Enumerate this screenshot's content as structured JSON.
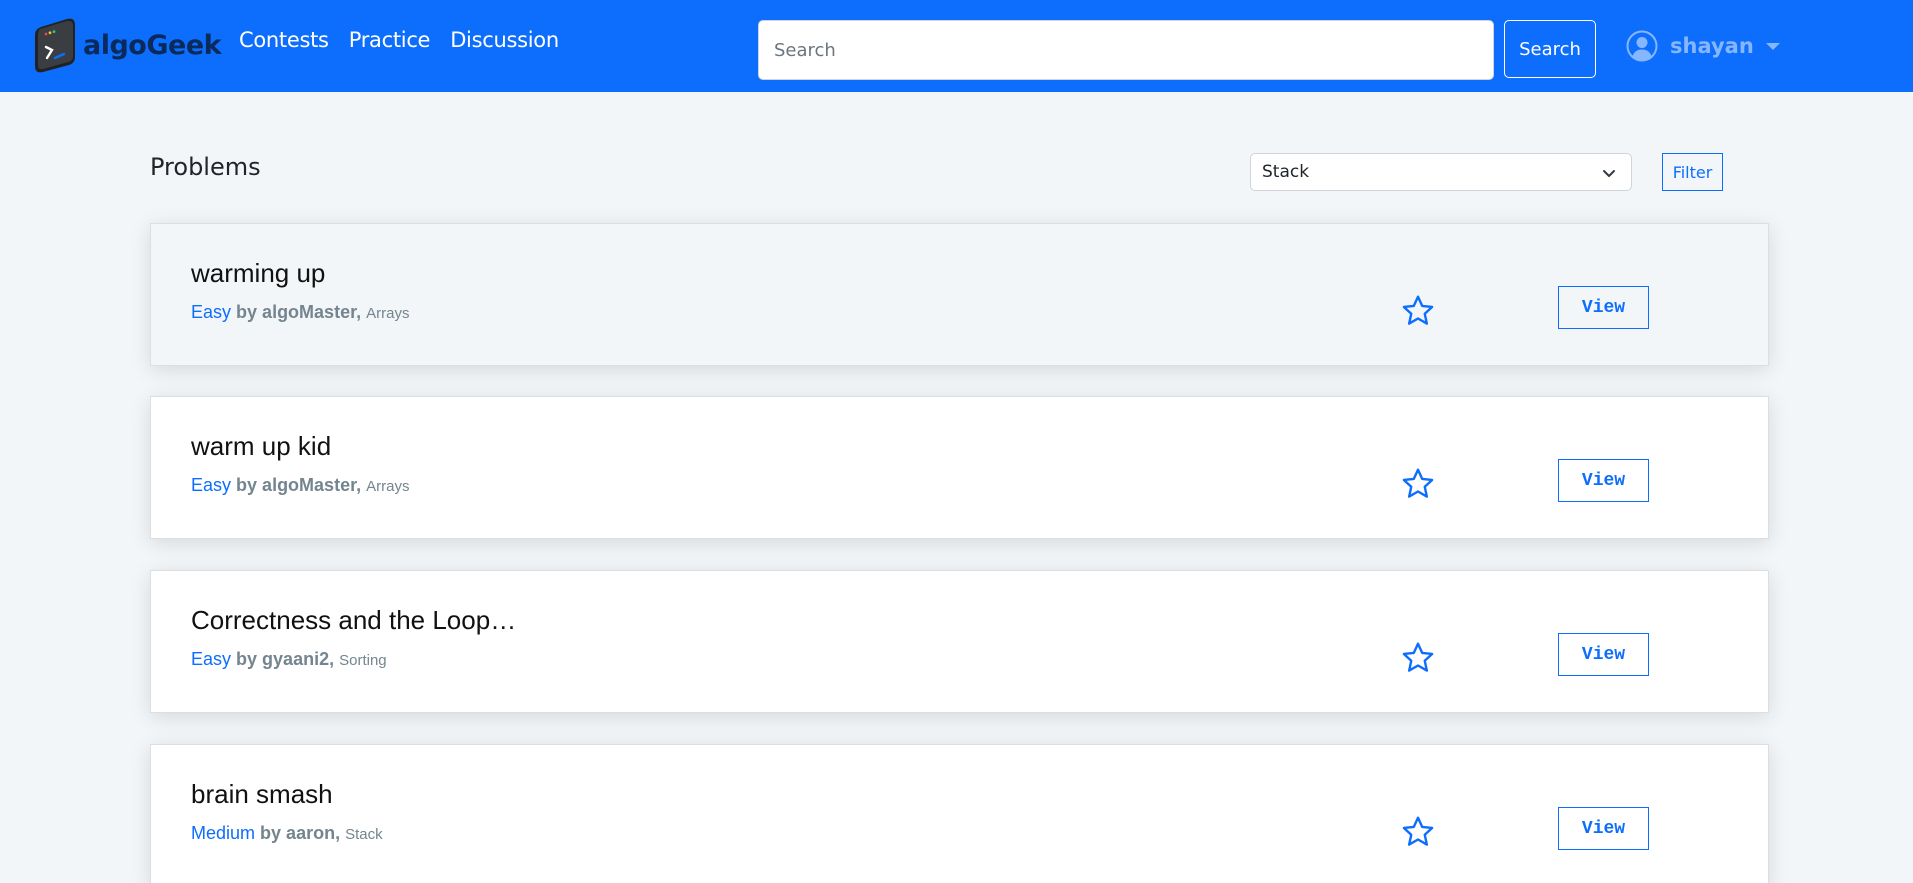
{
  "navbar": {
    "brand": "algoGeek",
    "links": [
      "Contests",
      "Practice",
      "Discussion"
    ],
    "search": {
      "placeholder": "Search",
      "value": "",
      "button_label": "Search"
    },
    "user": {
      "name": "shayan",
      "icon": "user-circle-icon"
    }
  },
  "main": {
    "title": "Problems",
    "filter": {
      "selected": "Stack",
      "button_label": "Filter"
    },
    "problems": [
      {
        "title": "warming up",
        "difficulty": "Easy",
        "author": "by algoMaster,",
        "tag": "Arrays",
        "view_label": "View",
        "highlighted": true
      },
      {
        "title": "warm up kid",
        "difficulty": "Easy",
        "author": "by algoMaster,",
        "tag": "Arrays",
        "view_label": "View",
        "highlighted": false
      },
      {
        "title": "Correctness and the Loop…",
        "difficulty": "Easy",
        "author": "by gyaani2,",
        "tag": "Sorting",
        "view_label": "View",
        "highlighted": false
      },
      {
        "title": "brain smash",
        "difficulty": "Medium",
        "author": "by aaron,",
        "tag": "Stack",
        "view_label": "View",
        "highlighted": false
      }
    ]
  },
  "colors": {
    "primary": "#0d6efd",
    "navbar_bg": "#0d6efd",
    "page_bg": "#f3f6f8",
    "muted_text": "#74858f",
    "user_name": "#86b7fe"
  }
}
